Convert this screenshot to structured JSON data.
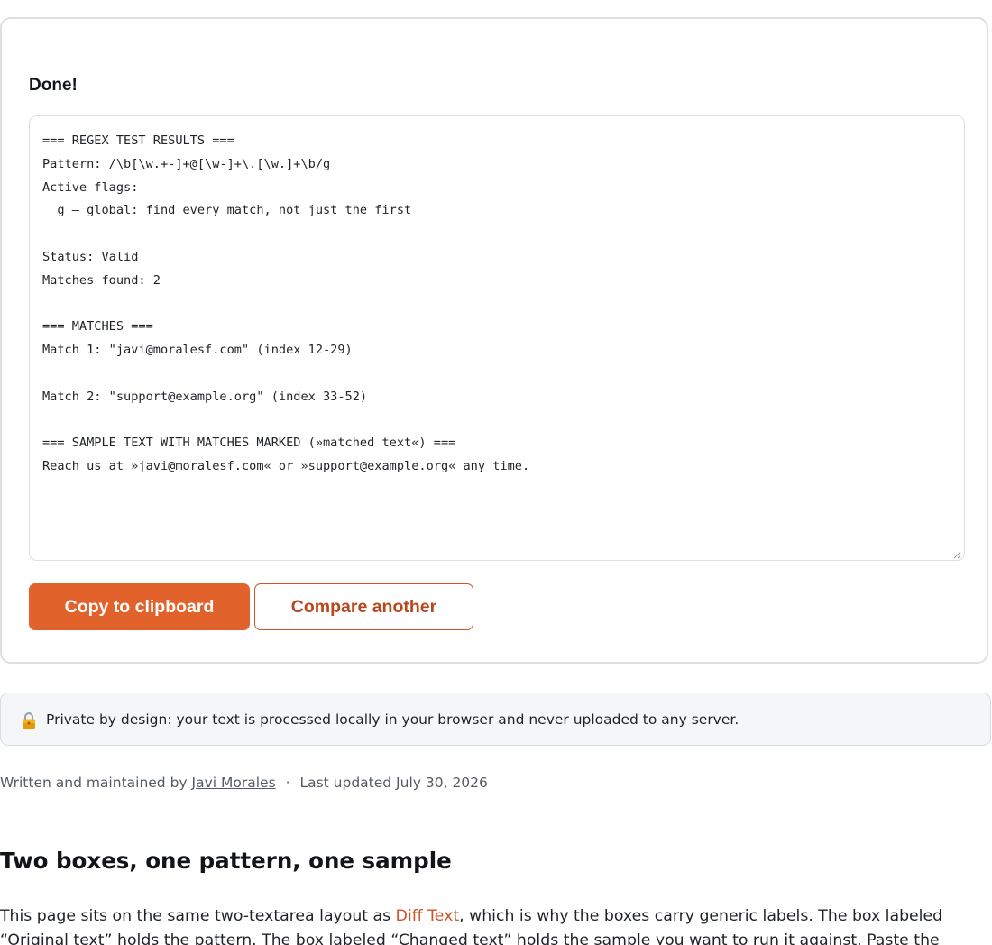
{
  "result": {
    "heading": "Done!",
    "output_text": "=== REGEX TEST RESULTS ===\nPattern: /\\b[\\w.+-]+@[\\w-]+\\.[\\w.]+\\b/g\nActive flags:\n  g — global: find every match, not just the first\n\nStatus: Valid\nMatches found: 2\n\n=== MATCHES ===\nMatch 1: \"javi@moralesf.com\" (index 12-29)\n\nMatch 2: \"support@example.org\" (index 33-52)\n\n=== SAMPLE TEXT WITH MATCHES MARKED (»matched text«) ===\nReach us at »javi@moralesf.com« or »support@example.org« any time.",
    "copy_button_label": "Copy to clipboard",
    "compare_button_label": "Compare another"
  },
  "privacy": {
    "icon": "lock-icon",
    "text": "Private by design: your text is processed locally in your browser and never uploaded to any server."
  },
  "byline": {
    "prefix": "Written and maintained by",
    "author": "Javi Morales",
    "separator": "·",
    "updated": "Last updated July 30, 2026"
  },
  "section": {
    "heading": "Two boxes, one pattern, one sample",
    "paragraph_before_link": "This page sits on the same two-textarea layout as ",
    "link_text": "Diff Text",
    "paragraph_after_link": ", which is why the boxes carry generic labels. The box labeled “Original text” holds the pattern. The box labeled “Changed text” holds the sample you want to run it against. Paste the pattern bare, without"
  },
  "colors": {
    "accent": "#e2622c",
    "accent_text": "#b8471d",
    "notice_bg": "#f4f6f8"
  }
}
